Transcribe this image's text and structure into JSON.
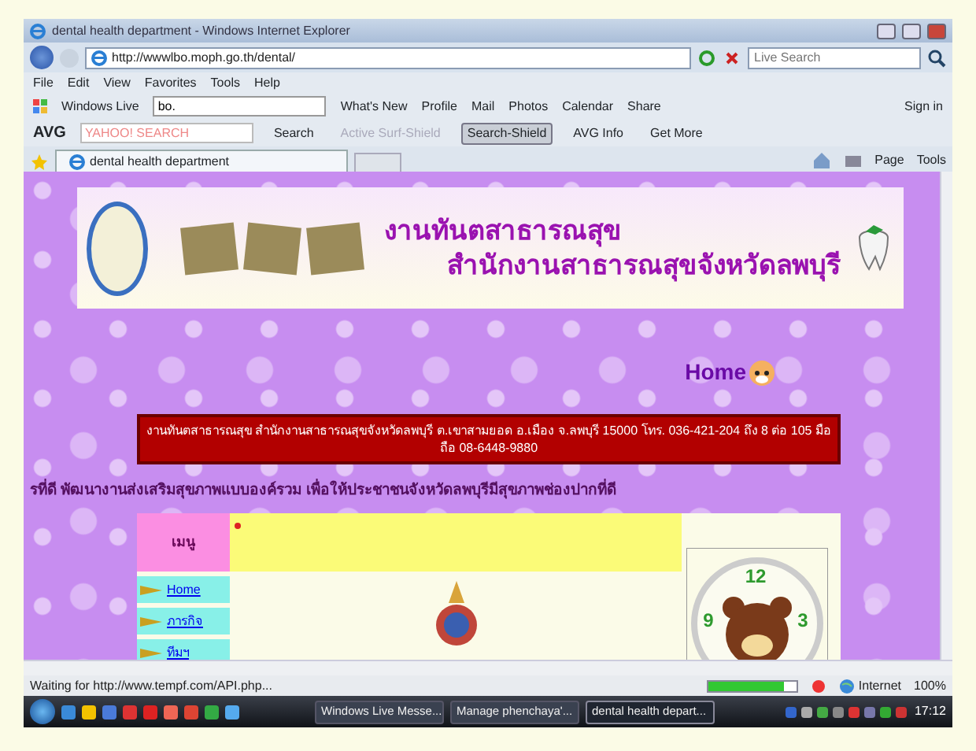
{
  "window": {
    "title": "dental health department - Windows Internet Explorer"
  },
  "address_bar": {
    "url": "http://wwwlbo.moph.go.th/dental/",
    "search_placeholder": "Live Search"
  },
  "menu_bar": [
    "File",
    "Edit",
    "View",
    "Favorites",
    "Tools",
    "Help"
  ],
  "live_toolbar": {
    "brand": "Windows Live",
    "search_value": "bo.",
    "links": [
      "What's New",
      "Profile",
      "Mail",
      "Photos",
      "Calendar",
      "Share"
    ],
    "sign_in": "Sign in"
  },
  "avg_toolbar": {
    "brand": "AVG",
    "search_placeholder": "YAHOO! SEARCH",
    "buttons": [
      {
        "label": "Search",
        "disabled": false,
        "pressed": false
      },
      {
        "label": "Active Surf-Shield",
        "disabled": true,
        "pressed": false
      },
      {
        "label": "Search-Shield",
        "disabled": false,
        "pressed": true
      },
      {
        "label": "AVG Info",
        "disabled": false,
        "pressed": false
      },
      {
        "label": "Get More",
        "disabled": false,
        "pressed": false
      }
    ]
  },
  "tabs": [
    {
      "label": "dental health department",
      "selected": true
    }
  ],
  "command_bar": [
    "Page",
    "Tools"
  ],
  "page": {
    "banner": {
      "title_line_1": "งานทันตสาธารณสุข",
      "title_line_2": "สำนักงานสาธารณสุขจังหวัดลพบุรี"
    },
    "home_link": "Home",
    "contact": "งานทันตสาธารณสุข สำนักงานสาธารณสุขจังหวัดลพบุรี ต.เขาสามยอด อ.เมือง จ.ลพบุรี 15000 โทร. 036-421-204 ถึง 8 ต่อ 105 มือถือ 08-6448-9880",
    "marquee": "รที่ดี พัฒนางานส่งเสริมสุขภาพแบบองค์รวม เพื่อให้ประชาชนจังหวัดลพบุรีมีสุขภาพช่องปากที่ดี",
    "menu": {
      "heading": "เมนู",
      "items": [
        "Home",
        "ภารกิจ",
        "ทีมฯ"
      ]
    },
    "clock": {
      "numerals": [
        "12",
        "9",
        "3"
      ]
    }
  },
  "status_bar": {
    "text": "Waiting for http://www.tempf.com/API.php...",
    "progress": {
      "level": 0.85
    },
    "zone": "Internet",
    "zoom": "100%"
  },
  "taskbar": {
    "buttons": [
      {
        "label": "Windows Live Messe...",
        "selected": false
      },
      {
        "label": "Manage phenchaya'...",
        "selected": false
      },
      {
        "label": "dental health depart...",
        "selected": true
      }
    ],
    "clock": "17:12"
  }
}
